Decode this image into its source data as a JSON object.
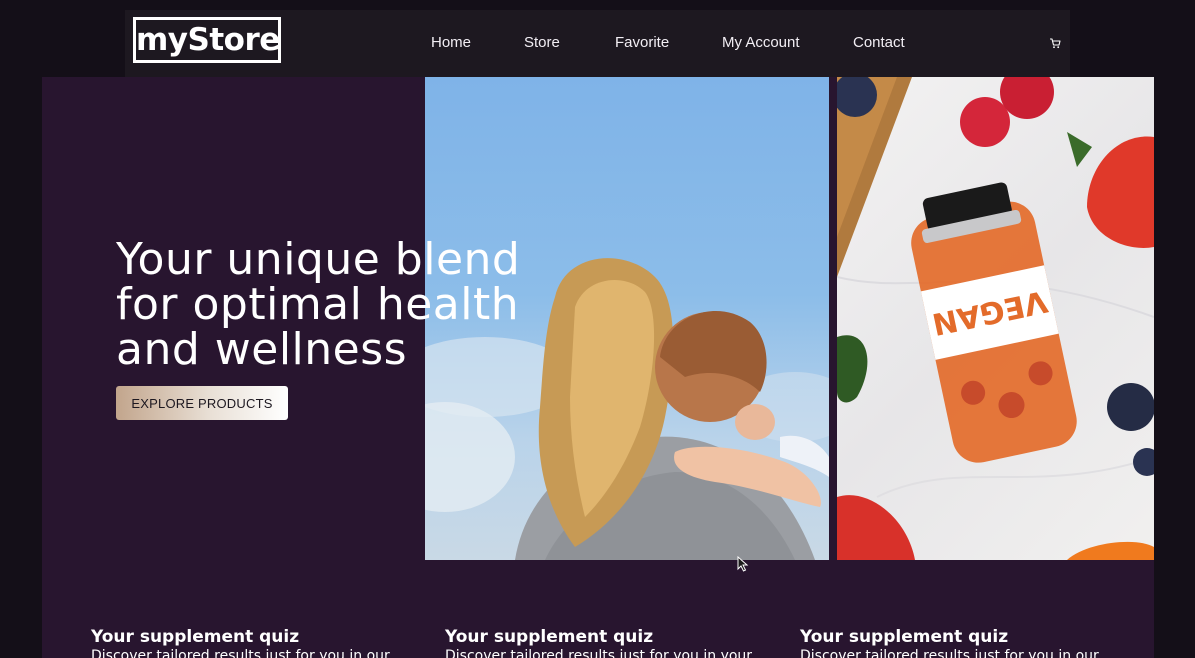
{
  "header": {
    "logo": "myStore",
    "nav": [
      {
        "label": "Home"
      },
      {
        "label": "Store"
      },
      {
        "label": "Favorite"
      },
      {
        "label": "My Account"
      },
      {
        "label": "Contact"
      }
    ],
    "cart_icon": "cart-icon"
  },
  "hero": {
    "title": "Your unique blend for optimal health and wellness",
    "cta_label": "EXPLORE PRODUCTS",
    "images": [
      {
        "description_icon": "photo-mother-child"
      },
      {
        "description_icon": "photo-vegan-supplement-bottle",
        "label_text": "VEGAN"
      }
    ]
  },
  "cards": [
    {
      "title": "Your supplement quiz",
      "desc": "Discover tailored results just for you in our"
    },
    {
      "title": "Your supplement quiz",
      "desc": "Discover tailored results just for you in your"
    },
    {
      "title": "Your supplement quiz",
      "desc": "Discover tailored results just for you in our"
    }
  ],
  "colors": {
    "page_bg": "#140f18",
    "header_bg": "#1d1820",
    "hero_bg": "#28152f",
    "accent_button": "#c2a58c"
  }
}
